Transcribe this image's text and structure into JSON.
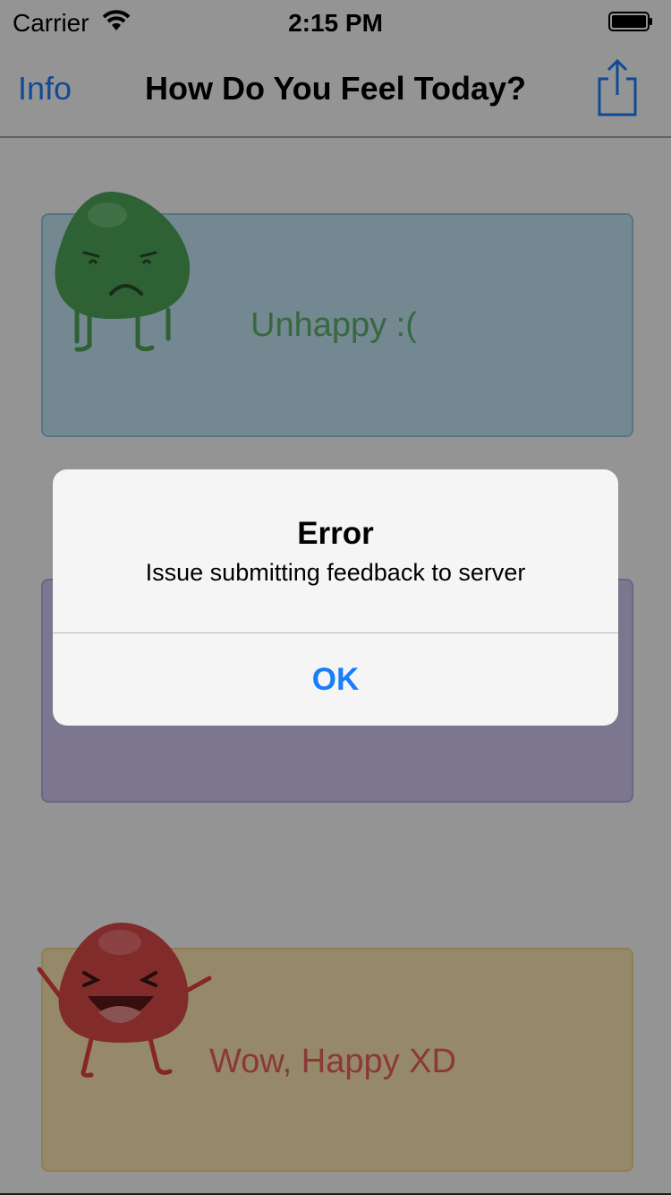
{
  "status_bar": {
    "carrier": "Carrier",
    "time": "2:15 PM"
  },
  "nav": {
    "left_button": "Info",
    "title": "How Do You Feel Today?",
    "right_icon": "share-icon"
  },
  "cards": [
    {
      "label": "Unhappy :(",
      "background": "#c2e3f2",
      "border": "#8ec3dc",
      "text_color": "#5dad6c",
      "mascot": "sad-green-mascot"
    },
    {
      "label": "",
      "background": "#cfc7ee",
      "border": "#b2a8df",
      "text_color": "#8a78c8",
      "mascot": ""
    },
    {
      "label": "Wow, Happy XD",
      "background": "#f9e4b0",
      "border": "#f0d28a",
      "text_color": "#e85e5e",
      "mascot": "happy-red-mascot"
    }
  ],
  "alert": {
    "title": "Error",
    "message": "Issue submitting feedback to server",
    "button": "OK"
  },
  "colors": {
    "accent": "#1a7ef7"
  }
}
